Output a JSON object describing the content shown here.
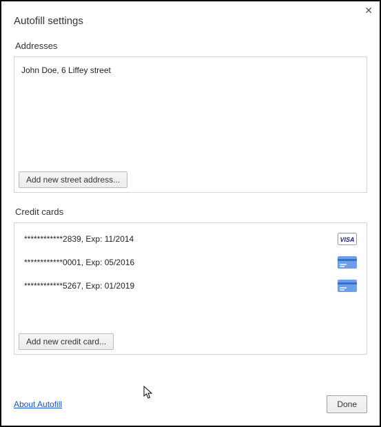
{
  "dialog": {
    "title": "Autofill settings",
    "close_aria": "Close"
  },
  "addresses": {
    "label": "Addresses",
    "items": [
      {
        "text": "John Doe, 6 Liffey street"
      }
    ],
    "add_button": "Add new street address..."
  },
  "cards": {
    "label": "Credit cards",
    "items": [
      {
        "text": "************2839, Exp: 11/2014",
        "brand": "visa"
      },
      {
        "text": "************0001, Exp: 05/2016",
        "brand": "generic"
      },
      {
        "text": "************5267, Exp: 01/2019",
        "brand": "generic"
      }
    ],
    "add_button": "Add new credit card..."
  },
  "footer": {
    "about_link": "About Autofill",
    "done": "Done"
  }
}
